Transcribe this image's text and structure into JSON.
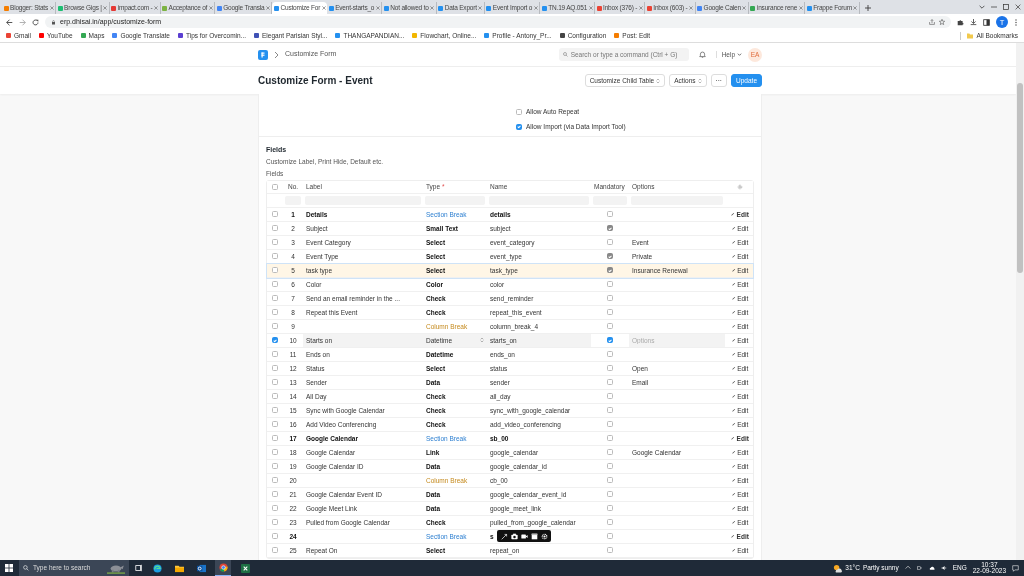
{
  "browser": {
    "tabs": [
      {
        "title": "Blogger: Stats",
        "color": "#f57d00",
        "selected": false
      },
      {
        "title": "Browse Gigs | ",
        "color": "#1dbf73",
        "selected": false
      },
      {
        "title": "impact.com - ",
        "color": "#e53935",
        "selected": false
      },
      {
        "title": "Acceptance of",
        "color": "#7cb342",
        "selected": false
      },
      {
        "title": "Google Transla",
        "color": "#4285f4",
        "selected": false
      },
      {
        "title": "Customize For",
        "color": "#2490ef",
        "selected": true
      },
      {
        "title": "Event-starts_o",
        "color": "#2490ef",
        "selected": false
      },
      {
        "title": "Not allowed to",
        "color": "#2490ef",
        "selected": false
      },
      {
        "title": "Data Export",
        "color": "#2490ef",
        "selected": false
      },
      {
        "title": "Event Import o",
        "color": "#2490ef",
        "selected": false
      },
      {
        "title": "TN.19 AQ.051",
        "color": "#2490ef",
        "selected": false
      },
      {
        "title": "Inbox (376) - ",
        "color": "#ea4335",
        "selected": false
      },
      {
        "title": "Inbox (603) - ",
        "color": "#ea4335",
        "selected": false
      },
      {
        "title": "Google Calen",
        "color": "#4285f4",
        "selected": false
      },
      {
        "title": "insurance rene",
        "color": "#34a853",
        "selected": false
      },
      {
        "title": "Frappe Forum",
        "color": "#2490ef",
        "selected": false
      }
    ],
    "address": "erp.dhisai.in/app/customize-form",
    "profile": "T",
    "bookmarks": [
      {
        "label": "Gmail",
        "color": "#ea4335"
      },
      {
        "label": "YouTube",
        "color": "#ff0000"
      },
      {
        "label": "Maps",
        "color": "#34a853"
      },
      {
        "label": "Google Translate",
        "color": "#4285f4"
      },
      {
        "label": "Tips for Overcomin...",
        "color": "#5b3fd1"
      },
      {
        "label": "Elegant Parisian Styl...",
        "color": "#3f51b5"
      },
      {
        "label": "THANGAPANDIAN...",
        "color": "#2490ef"
      },
      {
        "label": "Flowchart, Online...",
        "color": "#f2b600"
      },
      {
        "label": "Profile - Antony_Pr...",
        "color": "#2490ef"
      },
      {
        "label": "Configuration",
        "color": "#444444"
      },
      {
        "label": "Post: Edit",
        "color": "#f57d00"
      }
    ],
    "all_bookmarks": "All Bookmarks"
  },
  "navbar": {
    "breadcrumb": "Customize Form",
    "search": {
      "placeholder": "Search or type a command (Ctrl + G)"
    },
    "help": "Help",
    "avatar": "EA"
  },
  "page": {
    "title": "Customize Form - Event",
    "buttons": [
      {
        "label": "Customize Child Table",
        "kind": "dropdown"
      },
      {
        "label": "Actions",
        "kind": "dropdown"
      },
      {
        "label": "···",
        "kind": "more"
      },
      {
        "label": "Update",
        "kind": "primary"
      }
    ]
  },
  "settings": [
    {
      "label": "Allow Auto Repeat",
      "checked": false
    },
    {
      "label": "Allow Import (via Data Import Tool)",
      "checked": true
    }
  ],
  "fields_section": {
    "heading": "Fields",
    "description": "Customize Label, Print Hide, Default etc.",
    "table_label": "Fields",
    "select_all_checked": false,
    "columns": [
      {
        "label": "No."
      },
      {
        "label": "Label"
      },
      {
        "label": "Type",
        "required_mark": "*"
      },
      {
        "label": "Name"
      },
      {
        "label": "Mandatory"
      },
      {
        "label": "Options"
      }
    ],
    "rows": [
      {
        "no": "1",
        "label": "Details",
        "type": "Section Break",
        "kind": "section",
        "name": "details",
        "mandatory": false,
        "selected": false,
        "highlighted": false,
        "action": "Edit"
      },
      {
        "no": "2",
        "label": "Subject",
        "type": "Small Text",
        "kind": "field",
        "name": "subject",
        "mandatory": true,
        "selected": false,
        "highlighted": false,
        "action": "Edit"
      },
      {
        "no": "3",
        "label": "Event Category",
        "type": "Select",
        "kind": "field",
        "name": "event_category",
        "mandatory": false,
        "options": "Event",
        "selected": false,
        "highlighted": false,
        "action": "Edit"
      },
      {
        "no": "4",
        "label": "Event Type",
        "type": "Select",
        "kind": "field",
        "name": "event_type",
        "mandatory": true,
        "options": "Private",
        "selected": false,
        "highlighted": false,
        "action": "Edit"
      },
      {
        "no": "5",
        "label": "task type",
        "type": "Select",
        "kind": "field",
        "name": "task_type",
        "mandatory": true,
        "options": "Insurance Renewal",
        "selected": false,
        "highlighted": true,
        "action": "Edit"
      },
      {
        "no": "6",
        "label": "Color",
        "type": "Color",
        "kind": "field",
        "name": "color",
        "mandatory": false,
        "selected": false,
        "highlighted": false,
        "action": "Edit"
      },
      {
        "no": "7",
        "label": "Send an email reminder in the ...",
        "type": "Check",
        "kind": "field",
        "name": "send_reminder",
        "mandatory": false,
        "selected": false,
        "highlighted": false,
        "action": "Edit"
      },
      {
        "no": "8",
        "label": "Repeat this Event",
        "type": "Check",
        "kind": "field",
        "name": "repeat_this_event",
        "mandatory": false,
        "selected": false,
        "highlighted": false,
        "action": "Edit"
      },
      {
        "no": "9",
        "type": "Column Break",
        "kind": "column",
        "name": "column_break_4",
        "mandatory": false,
        "selected": false,
        "highlighted": false,
        "action": "Edit"
      },
      {
        "no": "10",
        "label": "Starts on",
        "type": "Datetime",
        "kind": "field",
        "name": "starts_on",
        "mandatory": true,
        "options_placeholder": "Options",
        "selected": true,
        "highlighted": false,
        "action": "Edit"
      },
      {
        "no": "11",
        "label": "Ends on",
        "type": "Datetime",
        "kind": "field",
        "name": "ends_on",
        "mandatory": false,
        "selected": false,
        "highlighted": false,
        "action": "Edit"
      },
      {
        "no": "12",
        "label": "Status",
        "type": "Select",
        "kind": "field",
        "name": "status",
        "mandatory": false,
        "options": "Open",
        "selected": false,
        "highlighted": false,
        "action": "Edit"
      },
      {
        "no": "13",
        "label": "Sender",
        "type": "Data",
        "kind": "field",
        "name": "sender",
        "mandatory": false,
        "options": "Email",
        "selected": false,
        "highlighted": false,
        "action": "Edit"
      },
      {
        "no": "14",
        "label": "All Day",
        "type": "Check",
        "kind": "field",
        "name": "all_day",
        "mandatory": false,
        "selected": false,
        "highlighted": false,
        "action": "Edit"
      },
      {
        "no": "15",
        "label": "Sync with Google Calendar",
        "type": "Check",
        "kind": "field",
        "name": "sync_with_google_calendar",
        "mandatory": false,
        "selected": false,
        "highlighted": false,
        "action": "Edit"
      },
      {
        "no": "16",
        "label": "Add Video Conferencing",
        "type": "Check",
        "kind": "field",
        "name": "add_video_conferencing",
        "mandatory": false,
        "selected": false,
        "highlighted": false,
        "action": "Edit"
      },
      {
        "no": "17",
        "label": "Google Calendar",
        "type": "Section Break",
        "kind": "section",
        "name": "sb_00",
        "mandatory": false,
        "selected": false,
        "highlighted": false,
        "action": "Edit"
      },
      {
        "no": "18",
        "label": "Google Calendar",
        "type": "Link",
        "kind": "field",
        "name": "google_calendar",
        "mandatory": false,
        "options": "Google Calendar",
        "selected": false,
        "highlighted": false,
        "action": "Edit"
      },
      {
        "no": "19",
        "label": "Google Calendar ID",
        "type": "Data",
        "kind": "field",
        "name": "google_calendar_id",
        "mandatory": false,
        "selected": false,
        "highlighted": false,
        "action": "Edit"
      },
      {
        "no": "20",
        "type": "Column Break",
        "kind": "column",
        "name": "cb_00",
        "mandatory": false,
        "selected": false,
        "highlighted": false,
        "action": "Edit"
      },
      {
        "no": "21",
        "label": "Google Calendar Event ID",
        "type": "Data",
        "kind": "field",
        "name": "google_calendar_event_id",
        "mandatory": false,
        "selected": false,
        "highlighted": false,
        "action": "Edit"
      },
      {
        "no": "22",
        "label": "Google Meet Link",
        "type": "Data",
        "kind": "field",
        "name": "google_meet_link",
        "mandatory": false,
        "selected": false,
        "highlighted": false,
        "action": "Edit"
      },
      {
        "no": "23",
        "label": "Pulled from Google Calendar",
        "type": "Check",
        "kind": "field",
        "name": "pulled_from_google_calendar",
        "mandatory": false,
        "selected": false,
        "highlighted": false,
        "action": "Edit"
      },
      {
        "no": "24",
        "type": "Section Break",
        "kind": "section",
        "name": "s",
        "mandatory": false,
        "selected": false,
        "highlighted": false,
        "action": "Edit"
      },
      {
        "no": "25",
        "label": "Repeat On",
        "type": "Select",
        "kind": "field",
        "name": "repeat_on",
        "mandatory": false,
        "selected": false,
        "highlighted": false,
        "action": "Edit"
      }
    ]
  },
  "taskbar": {
    "search": {
      "placeholder": "Type here to search"
    },
    "weather": {
      "temp": "31°C",
      "condition": "Partly sunny"
    },
    "language": "ENG",
    "time": "10:37",
    "date": "22-09-2023"
  }
}
